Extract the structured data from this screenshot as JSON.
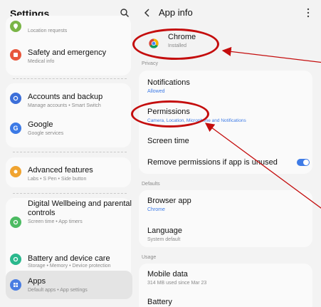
{
  "left_panel": {
    "title": "Settings",
    "icons": {
      "search": "search-icon"
    },
    "items": [
      {
        "name": "Location",
        "subtitle": "Location requests",
        "icon": "location-icon",
        "color": "#7ab547"
      },
      {
        "name": "Safety and emergency",
        "subtitle": "Medical info",
        "icon": "alert-icon",
        "color": "#e8563c"
      },
      {
        "name": "Accounts and backup",
        "subtitle": "Manage accounts  •  Smart Switch",
        "icon": "sync-icon",
        "color": "#3c6fd9"
      },
      {
        "name": "Google",
        "subtitle": "Google services",
        "icon": "google-icon",
        "color": "#3c7ae6"
      },
      {
        "name": "Advanced features",
        "subtitle": "Labs  •  S Pen  •  Side button",
        "icon": "star-icon",
        "color": "#f0a431"
      },
      {
        "name_line1": "Digital Wellbeing and parental",
        "name_line2": "controls",
        "subtitle": "Screen time  •  App timers",
        "icon": "wellbeing-icon",
        "color": "#4cbb62"
      },
      {
        "name": "Battery and device care",
        "subtitle": "Storage  •  Memory  •  Device protection",
        "icon": "battery-care-icon",
        "color": "#2ab88d"
      },
      {
        "name": "Apps",
        "subtitle": "Default apps  •  App settings",
        "icon": "apps-icon",
        "color": "#4a7de2"
      }
    ]
  },
  "right_panel": {
    "title": "App info",
    "icons": {
      "back": "back-icon",
      "more": "more-options-icon"
    },
    "app": {
      "name": "Chrome",
      "status": "Installed",
      "icon": "chrome-icon"
    },
    "privacy": {
      "header": "Privacy",
      "notifications": {
        "name": "Notifications",
        "value": "Allowed"
      },
      "permissions": {
        "name": "Permissions",
        "value": "Camera, Location, Microphone and Notifications"
      },
      "screen_time": {
        "name": "Screen time"
      },
      "remove_permissions": {
        "name": "Remove permissions if app is unused",
        "enabled": true
      }
    },
    "defaults": {
      "header": "Defaults",
      "browser_app": {
        "name": "Browser app",
        "value": "Chrome"
      },
      "language": {
        "name": "Language",
        "value": "System default"
      }
    },
    "usage": {
      "header": "Usage",
      "mobile_data": {
        "name": "Mobile data",
        "value": "314 MB used since Mar 23"
      },
      "battery": {
        "name": "Battery"
      }
    }
  },
  "colors": {
    "accent_blue": "#3e7be6",
    "annotation_red": "#c40d0d"
  }
}
